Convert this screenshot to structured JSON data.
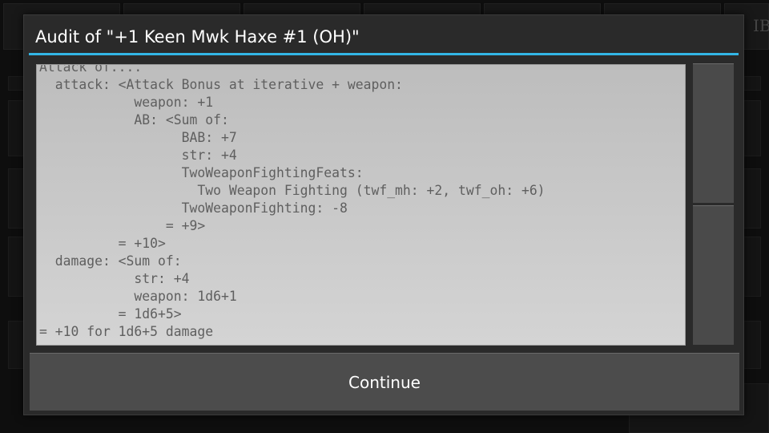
{
  "background": {
    "partial_tab_label": "IB"
  },
  "dialog": {
    "title": "Audit of \"+1 Keen Mwk Haxe #1 (OH)\"",
    "accent_color": "#33b5e5",
    "audit_lines": [
      "Attack of....",
      "  attack: <Attack Bonus at iterative + weapon:",
      "            weapon: +1",
      "            AB: <Sum of:",
      "                  BAB: +7",
      "                  str: +4",
      "                  TwoWeaponFightingFeats:",
      "                    Two Weapon Fighting (twf_mh: +2, twf_oh: +6)",
      "                  TwoWeaponFighting: -8",
      "                = +9>",
      "          = +10>",
      "  damage: <Sum of:",
      "            str: +4",
      "            weapon: 1d6+1",
      "          = 1d6+5>",
      "= +10 for 1d6+5 damage"
    ],
    "continue_label": "Continue"
  }
}
